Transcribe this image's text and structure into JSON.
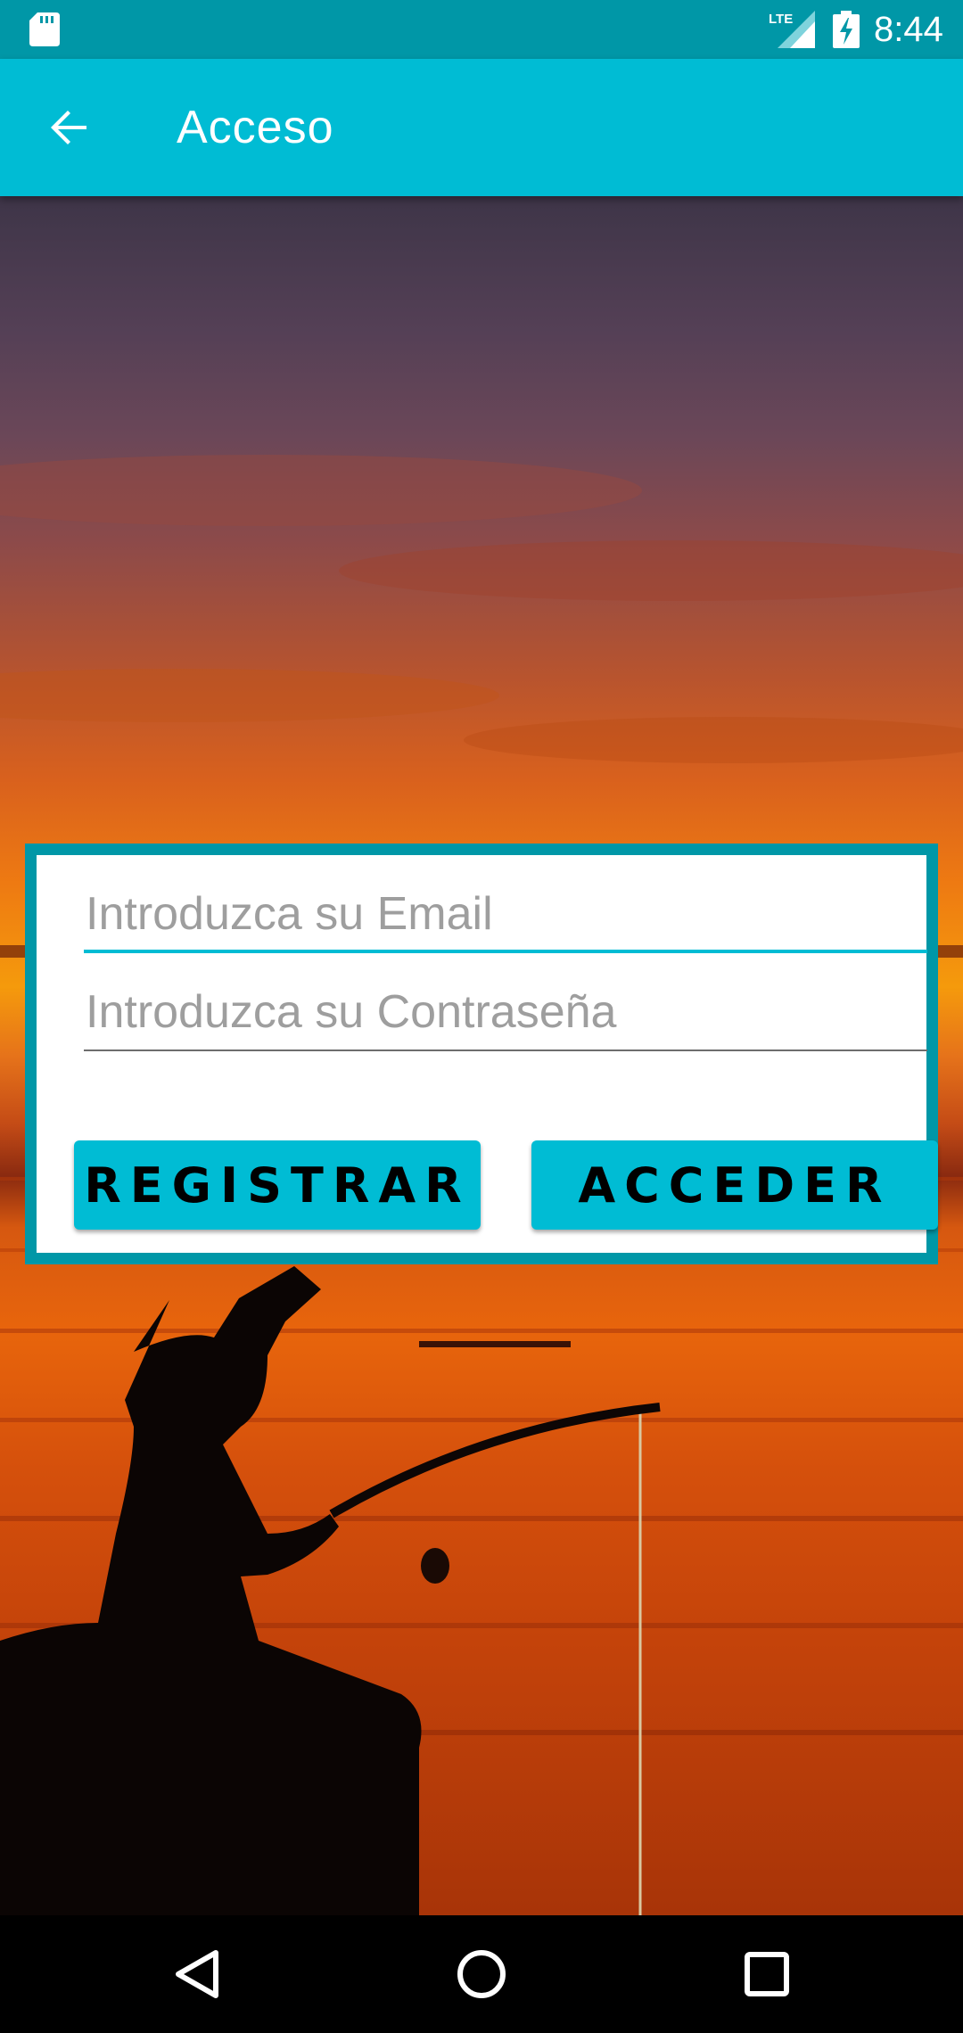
{
  "status_bar": {
    "time": "8:44",
    "network_label": "LTE",
    "icons": [
      "sd-card-icon",
      "lte-signal-icon",
      "battery-charging-icon"
    ]
  },
  "app_bar": {
    "title": "Acceso",
    "back_icon": "arrow-back-icon",
    "color": "#00bcd4"
  },
  "login": {
    "email_placeholder": "Introduzca su Email",
    "email_value": "",
    "password_placeholder": "Introduzca su Contraseña",
    "password_value": "",
    "register_label": "REGISTRAR",
    "login_label": "ACCEDER",
    "accent_color": "#00bcd4",
    "border_color": "#0097a7"
  },
  "nav_bar": {
    "icons": [
      "nav-back-icon",
      "nav-home-icon",
      "nav-recents-icon"
    ]
  }
}
